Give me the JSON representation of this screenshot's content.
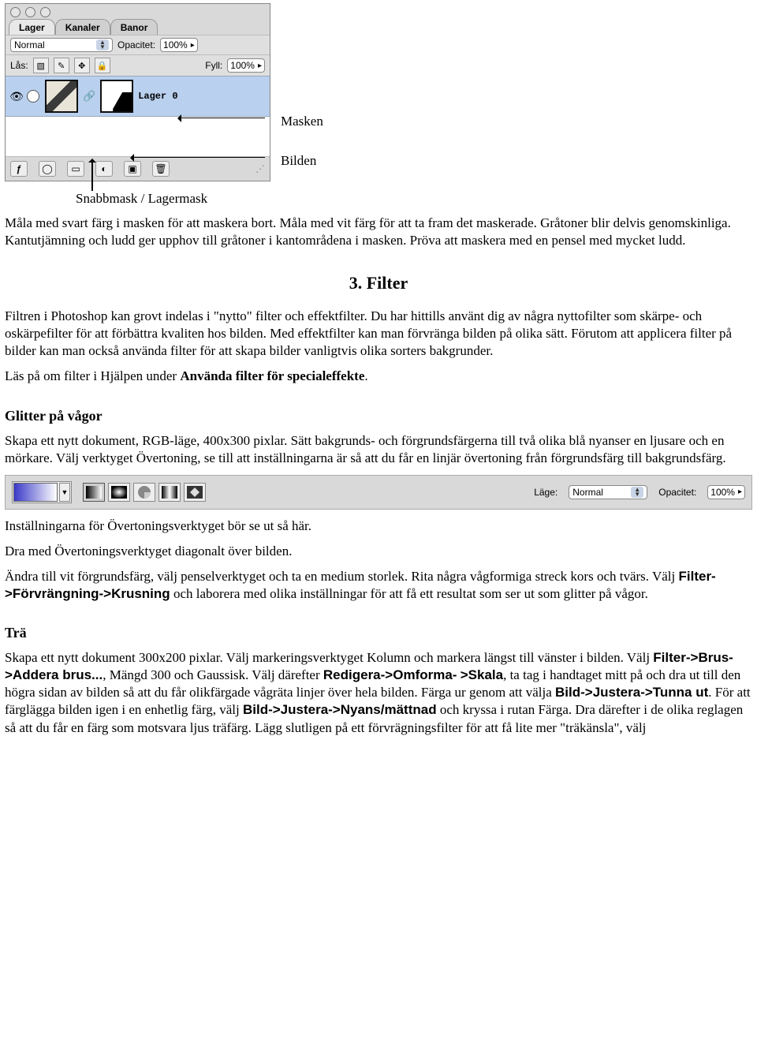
{
  "panel": {
    "tabs": {
      "lager": "Lager",
      "kanaler": "Kanaler",
      "banor": "Banor"
    },
    "mode_label": "Normal",
    "opacity_label": "Opacitet:",
    "opacity_value": "100%",
    "lock_label": "Lås:",
    "fill_label": "Fyll:",
    "fill_value": "100%",
    "layer_name": "Lager 0"
  },
  "annotations": {
    "mask": "Masken",
    "image": "Bilden",
    "quickmask": "Snabbmask / Lagermask"
  },
  "body": {
    "p1": "Måla med svart färg i masken för att maskera bort. Måla med vit färg för att ta fram det maskerade. Gråtoner blir delvis genomskinliga. Kantutjämning och ludd ger upphov till gråtoner i kantområdena i masken. Pröva att maskera med en pensel med mycket ludd.",
    "section3": "3. Filter",
    "p2": "Filtren i Photoshop kan grovt indelas i \"nytto\" filter och effektfilter. Du har hittills använt dig av några nyttofilter som skärpe- och oskärpefilter för att förbättra kvaliten hos bilden. Med effektfilter kan man förvränga bilden på olika sätt. Förutom att applicera filter på bilder kan man också använda filter för att skapa bilder vanligtvis olika sorters bakgrunder.",
    "p3_pre": "Läs på om filter i Hjälpen under ",
    "p3_bold": "Använda filter för specialeffekte",
    "p3_post": ".",
    "glitter_h": "Glitter på vågor",
    "p4": "Skapa ett nytt dokument, RGB-läge, 400x300 pixlar. Sätt bakgrunds- och förgrundsfärgerna till två olika blå nyanser en ljusare och en mörkare. Välj verktyget Övertoning, se till att inställningarna är så att du får en linjär övertoning från förgrundsfärg till bakgrundsfärg.",
    "p5": "Inställningarna för Övertoningsverktyget bör se ut så här.",
    "p6": "Dra med Övertoningsverktyget diagonalt över bilden.",
    "p7_pre": "Ändra till vit förgrundsfärg, välj penselverktyget och ta en medium storlek. Rita några vågformiga streck kors och tvärs. Välj ",
    "p7_menu": "Filter->Förvrängning->Krusning",
    "p7_post": " och laborera med olika inställningar för att få ett resultat som ser ut som glitter på vågor.",
    "tra_h": "Trä",
    "p8_a": "Skapa ett nytt dokument 300x200 pixlar. Välj markeringsverktyget Kolumn och markera längst till vänster i bilden. Välj ",
    "p8_m1": "Filter->Brus->Addera brus...",
    "p8_b": ", Mängd 300 och Gaussisk. Välj därefter ",
    "p8_m2": "Redigera->Omforma-",
    "p9_m1": ">Skala",
    "p9_a": ", ta tag i handtaget mitt på och dra ut till den högra sidan av bilden så att du får olikfärgade vågräta linjer över hela bilden. Färga ur genom att välja ",
    "p9_m2": "Bild->Justera->Tunna ut",
    "p9_b": ". För att färglägga bilden igen i en enhetlig färg, välj ",
    "p9_m3": "Bild->Justera->Nyans/mättnad",
    "p9_c": " och kryssa i rutan Färga. Dra därefter i de olika reglagen så att du får en färg som motsvara ljus träfärg. Lägg slutligen på ett förvrägningsfilter för att få lite mer \"träkänsla\", välj"
  },
  "gradbar": {
    "mode_label": "Läge:",
    "mode_value": "Normal",
    "opacity_label": "Opacitet:",
    "opacity_value": "100%"
  }
}
